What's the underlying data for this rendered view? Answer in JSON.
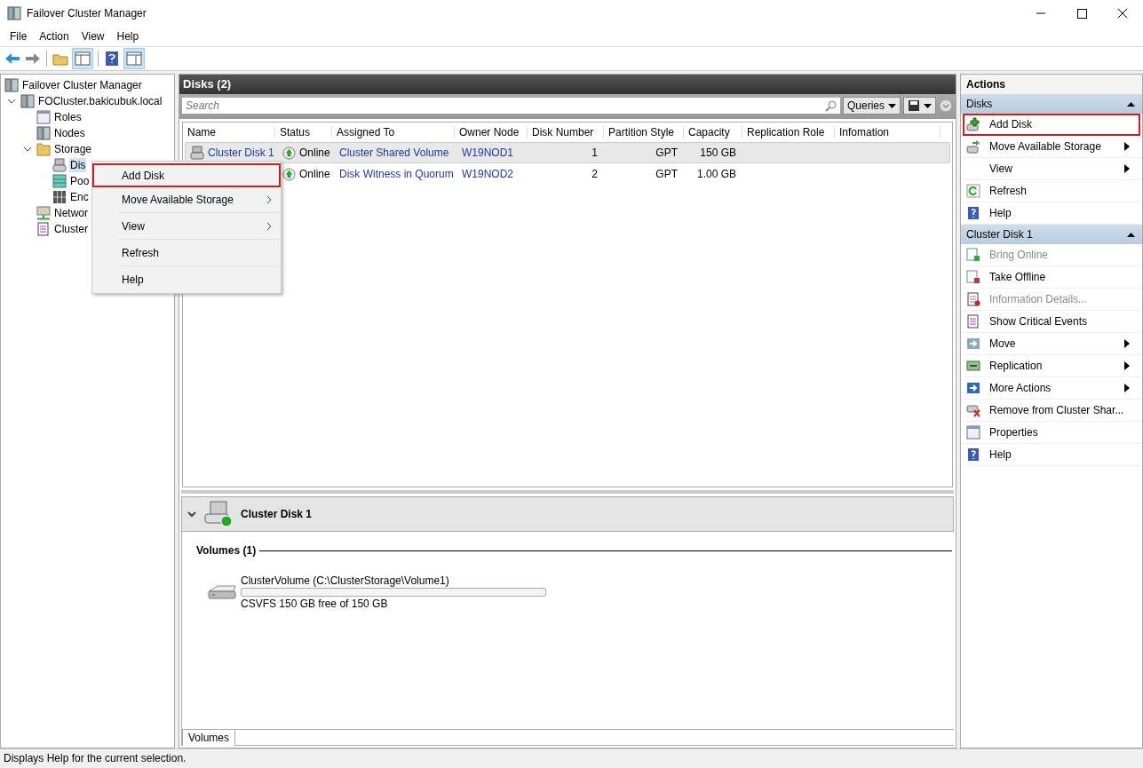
{
  "window": {
    "title": "Failover Cluster Manager"
  },
  "menu_bar": [
    "File",
    "Action",
    "View",
    "Help"
  ],
  "tree": [
    {
      "label": "Failover Cluster Manager",
      "kind": "cluster",
      "selected": false,
      "children": [
        {
          "label": "FOCluster.bakicubuk.local",
          "kind": "cluster",
          "expanded": true,
          "selected": false,
          "children": [
            {
              "label": "Roles",
              "kind": "roles",
              "selected": false
            },
            {
              "label": "Nodes",
              "kind": "nodes",
              "selected": false
            },
            {
              "label": "Storage",
              "kind": "folder",
              "expanded": true,
              "selected": false,
              "children": [
                {
                  "label": "Dis",
                  "kind": "disk",
                  "selected": true
                },
                {
                  "label": "Poo",
                  "kind": "pool",
                  "selected": false
                },
                {
                  "label": "Enc",
                  "kind": "enclosure",
                  "selected": false
                }
              ]
            },
            {
              "label": "Networ",
              "kind": "network",
              "selected": false
            },
            {
              "label": "Cluster",
              "kind": "events",
              "selected": false
            }
          ]
        }
      ]
    }
  ],
  "context_menu": [
    {
      "label": "Add Disk",
      "submenu": false,
      "outlined": true
    },
    {
      "label": "Move Available Storage",
      "submenu": true,
      "outlined": false
    },
    {
      "label": "View",
      "submenu": true,
      "outlined": false
    },
    {
      "label": "Refresh",
      "submenu": false,
      "outlined": false
    },
    {
      "label": "Help",
      "submenu": false,
      "outlined": false
    }
  ],
  "disks_panel": {
    "title": "Disks (2)",
    "search": {
      "placeholder": "Search"
    },
    "queries": "Queries",
    "columns": [
      "Name",
      "Status",
      "Assigned To",
      "Owner Node",
      "Disk Number",
      "Partition Style",
      "Capacity",
      "Replication Role",
      "Infomation"
    ],
    "rows": [
      {
        "name": "Cluster Disk 1",
        "status": "Online",
        "assigned_to": "Cluster Shared Volume",
        "owner_node": "W19NOD1",
        "disk_number": "1",
        "partition_style": "GPT",
        "capacity": "150 GB",
        "selected": true
      },
      {
        "status": "Online",
        "assigned_to": "Disk Witness in Quorum",
        "owner_node": "W19NOD2",
        "disk_number": "2",
        "partition_style": "GPT",
        "capacity": "1.00 GB",
        "selected": false
      }
    ]
  },
  "details": {
    "title": "Cluster Disk 1",
    "section": "Volumes (1)",
    "volume": {
      "name": "ClusterVolume (C:\\ClusterStorage\\Volume1)",
      "level": 0,
      "info": "CSVFS 150 GB free of 150 GB"
    },
    "tab": "Volumes"
  },
  "actions": {
    "title": "Actions",
    "groups": [
      {
        "title": "Disks",
        "items": [
          {
            "label": "Add Disk",
            "kind": "diskadd",
            "disabled": false,
            "submenu": false,
            "outlined": true
          },
          {
            "label": "Move Available Storage",
            "kind": "diskmove",
            "disabled": false,
            "submenu": true,
            "outlined": false
          },
          {
            "label": "View",
            "kind": "plain",
            "disabled": false,
            "submenu": true,
            "outlined": false
          },
          {
            "label": "Refresh",
            "kind": "refresh",
            "disabled": false,
            "submenu": false,
            "outlined": false
          },
          {
            "label": "Help",
            "kind": "help",
            "disabled": false,
            "submenu": false,
            "outlined": false
          }
        ]
      },
      {
        "title": "Cluster Disk 1",
        "items": [
          {
            "label": "Bring Online",
            "kind": "online",
            "disabled": true,
            "submenu": false,
            "outlined": false
          },
          {
            "label": "Take Offline",
            "kind": "offline",
            "disabled": false,
            "submenu": false,
            "outlined": false
          },
          {
            "label": "Information Details...",
            "kind": "info",
            "disabled": true,
            "submenu": false,
            "outlined": false
          },
          {
            "label": "Show Critical Events",
            "kind": "events",
            "disabled": false,
            "submenu": false,
            "outlined": false
          },
          {
            "label": "Move",
            "kind": "move",
            "disabled": false,
            "submenu": true,
            "outlined": false
          },
          {
            "label": "Replication",
            "kind": "replication",
            "disabled": false,
            "submenu": true,
            "outlined": false
          },
          {
            "label": "More Actions",
            "kind": "more",
            "disabled": false,
            "submenu": true,
            "outlined": false
          },
          {
            "label": "Remove from Cluster Shar...",
            "kind": "remove",
            "disabled": false,
            "submenu": false,
            "outlined": false
          },
          {
            "label": "Properties",
            "kind": "properties",
            "disabled": false,
            "submenu": false,
            "outlined": false
          },
          {
            "label": "Help",
            "kind": "help",
            "disabled": false,
            "submenu": false,
            "outlined": false
          }
        ]
      }
    ]
  },
  "status_bar": "Displays Help for the current selection."
}
